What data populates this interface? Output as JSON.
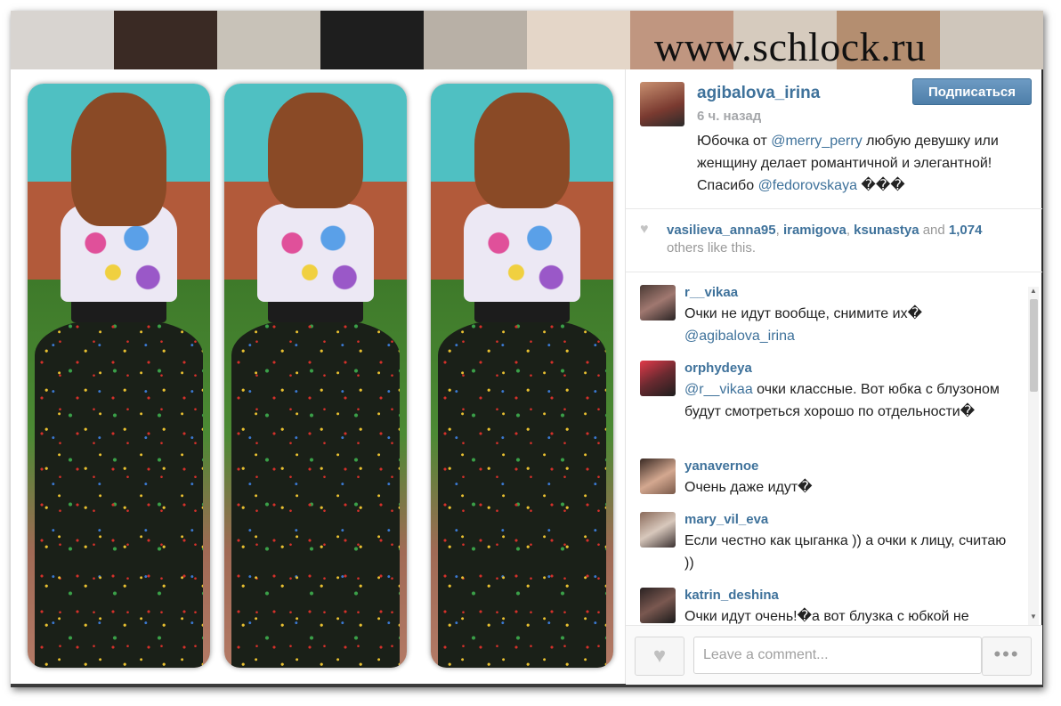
{
  "watermark": "www.schlock.ru",
  "post": {
    "username": "agibalova_irina",
    "follow_label": "Подписаться",
    "time_ago": "6 ч. назад",
    "caption": {
      "part1": "Юбочка от ",
      "mention1": "@merry_perry",
      "part2": " любую девушку или женщину делает романтичной и элегантной! Спасибо ",
      "mention2": "@fedorovskaya",
      "part3": " ���"
    }
  },
  "likes": {
    "user1": "vasilieva_anna95",
    "sep1": ", ",
    "user2": "iramigova",
    "sep2": ", ",
    "user3": "ksunastya",
    "and": " and ",
    "count": "1,074",
    "others": " others like this."
  },
  "comments": [
    {
      "user": "r__vikaa",
      "text": "Очки не идут вообще, снимите их� ",
      "mention": "@agibalova_irina",
      "after": ""
    },
    {
      "user": "orphydeya",
      "text": "",
      "mention": "@r__vikaa",
      "after": " очки классные. Вот юбка с блузоном будут смотреться хорошо по отдельности�"
    },
    {
      "user": "yanavernoe",
      "text": "Очень даже идут�",
      "mention": "",
      "after": ""
    },
    {
      "user": "mary_vil_eva",
      "text": "Если честно как цыганка )) а очки к лицу, считаю ))",
      "mention": "",
      "after": ""
    },
    {
      "user": "katrin_deshina",
      "text": "Очки идут очень!�а вот блузка с юбкой не",
      "mention": "",
      "after": ""
    }
  ],
  "footer": {
    "comment_placeholder": "Leave a comment...",
    "more_label": "•••"
  },
  "colors": {
    "link": "#3f729b",
    "follow_button": "#4e7fa9",
    "muted": "#a5a7aa"
  },
  "icons": {
    "like": "heart-icon",
    "more": "ellipsis-icon"
  }
}
